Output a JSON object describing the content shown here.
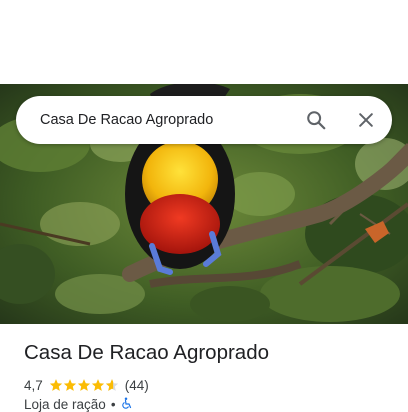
{
  "search": {
    "query": "Casa De Racao Agroprado"
  },
  "place": {
    "name": "Casa De Racao Agroprado",
    "rating": "4,7",
    "rating_value": 4.7,
    "review_count": "(44)",
    "category": "Loja de ração",
    "separator": "•",
    "accessibility_icon": "wheelchair-icon"
  },
  "colors": {
    "star": "#fbbc04",
    "accessibility": "#1a73e8",
    "icon": "#5f6368"
  }
}
